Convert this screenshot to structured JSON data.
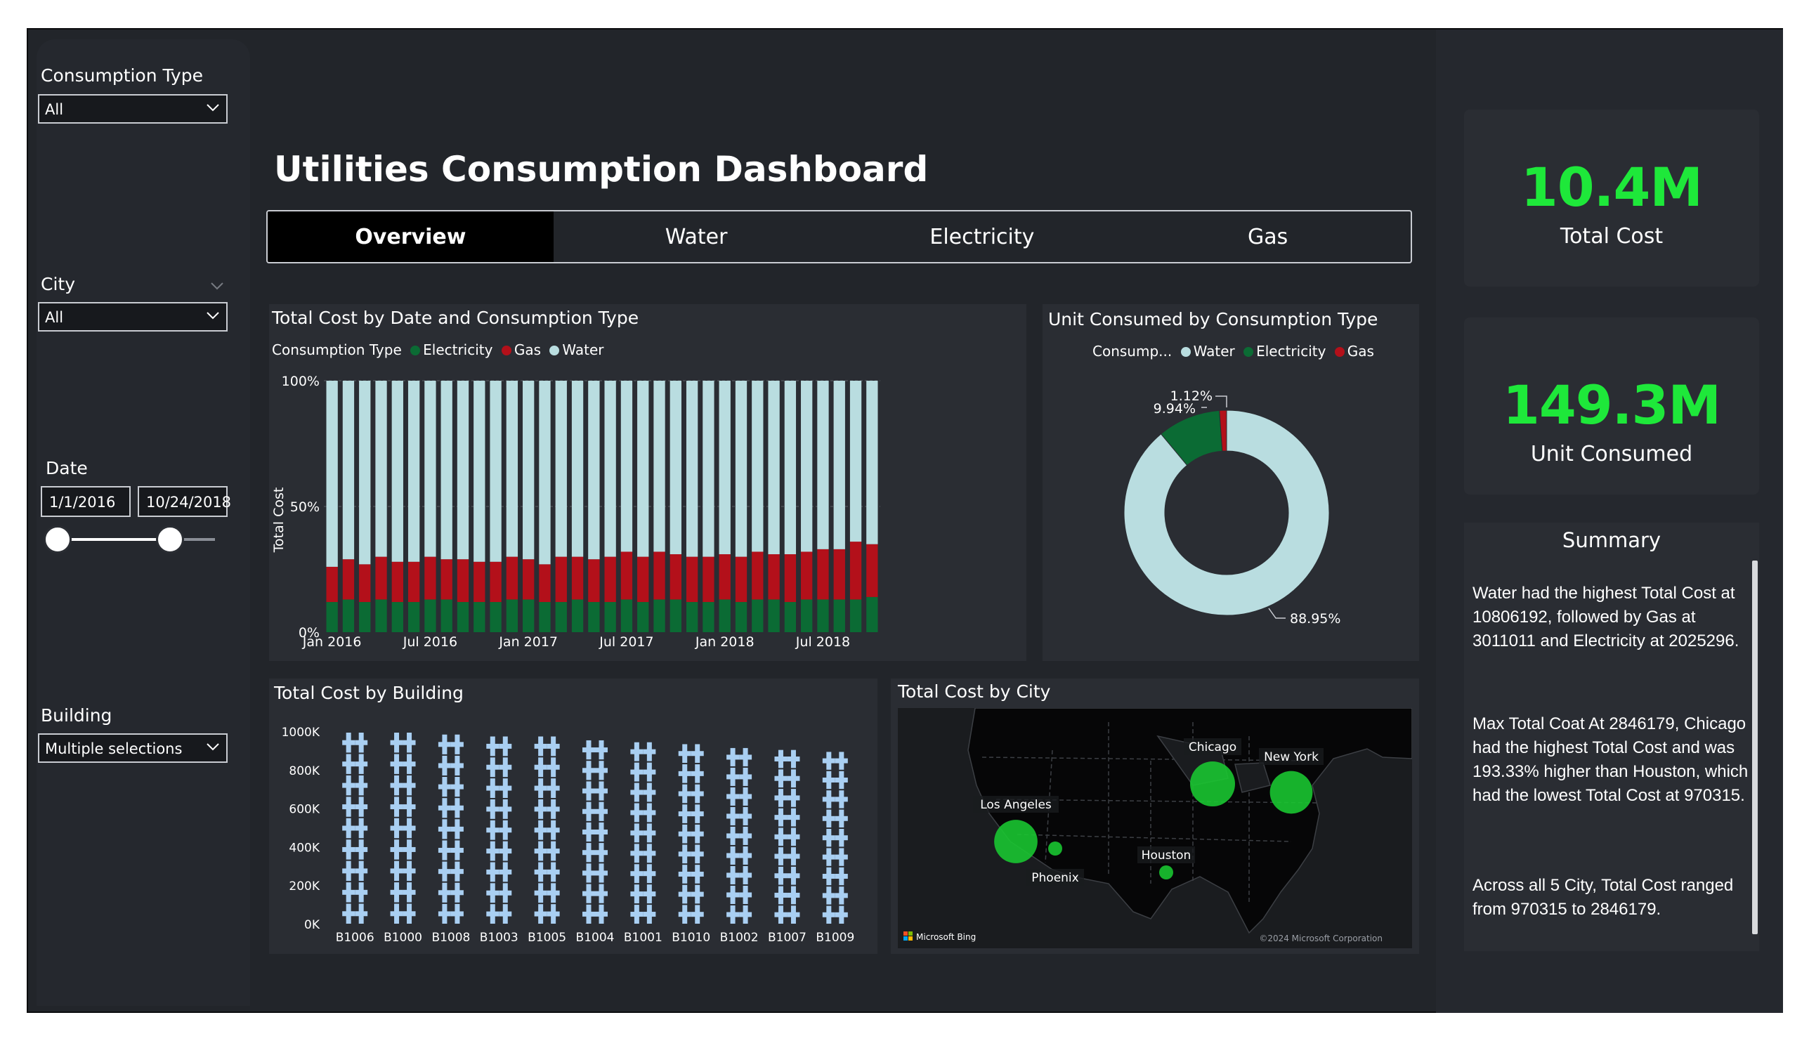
{
  "title": "Utilities Consumption Dashboard",
  "filters": {
    "consumption_type": {
      "label": "Consumption Type",
      "value": "All"
    },
    "city": {
      "label": "City",
      "value": "All"
    },
    "date": {
      "label": "Date",
      "start": "1/1/2016",
      "end": "10/24/2018"
    },
    "building": {
      "label": "Building",
      "value": "Multiple selections"
    }
  },
  "tabs": [
    {
      "label": "Overview",
      "active": true
    },
    {
      "label": "Water",
      "active": false
    },
    {
      "label": "Electricity",
      "active": false
    },
    {
      "label": "Gas",
      "active": false
    }
  ],
  "kpis": {
    "total_cost": {
      "value": "10.4M",
      "label": "Total Cost"
    },
    "unit_consumed": {
      "value": "149.3M",
      "label": "Unit Consumed"
    }
  },
  "summary": {
    "title": "Summary",
    "paragraphs": [
      "Water had the highest Total Cost at 10806192, followed by Gas at 3011011 and Electricity at 2025296.",
      "Max Total Coat  At 2846179, Chicago had the highest Total Cost and was 193.33% higher than Houston, which had the lowest Total Cost at 970315.",
      "Across all 5 City, Total Cost ranged from 970315 to 2846179."
    ]
  },
  "colors": {
    "electricity": "#0b6b34",
    "gas": "#b3101a",
    "water": "#b9dde0",
    "kpi": "#1ee83a",
    "map_bubble": "#19c531"
  },
  "chart_data": [
    {
      "type": "bar",
      "stacking": "percent",
      "title": "Total Cost by Date and Consumption Type",
      "legend_title": "Consumption Type",
      "ylabel": "Total Cost",
      "y_ticks": [
        "0%",
        "50%",
        "100%"
      ],
      "x_ticks": [
        "Jan 2016",
        "Jul 2016",
        "Jan 2017",
        "Jul 2017",
        "Jan 2018",
        "Jul 2018"
      ],
      "grid": true,
      "categories": [
        "2016-01",
        "2016-02",
        "2016-03",
        "2016-04",
        "2016-05",
        "2016-06",
        "2016-07",
        "2016-08",
        "2016-09",
        "2016-10",
        "2016-11",
        "2016-12",
        "2017-01",
        "2017-02",
        "2017-03",
        "2017-04",
        "2017-05",
        "2017-06",
        "2017-07",
        "2017-08",
        "2017-09",
        "2017-10",
        "2017-11",
        "2017-12",
        "2018-01",
        "2018-02",
        "2018-03",
        "2018-04",
        "2018-05",
        "2018-06",
        "2018-07",
        "2018-08",
        "2018-09",
        "2018-10"
      ],
      "series": [
        {
          "name": "Electricity",
          "values": [
            12,
            13,
            12,
            13,
            12,
            12,
            13,
            13,
            12,
            12,
            12,
            13,
            13,
            12,
            12,
            13,
            12,
            12,
            13,
            12,
            13,
            13,
            12,
            12,
            13,
            12,
            13,
            13,
            12,
            13,
            13,
            13,
            13,
            14
          ]
        },
        {
          "name": "Gas",
          "values": [
            14,
            16,
            15,
            17,
            16,
            16,
            17,
            16,
            17,
            16,
            16,
            17,
            16,
            15,
            18,
            17,
            17,
            18,
            19,
            18,
            19,
            18,
            18,
            18,
            18,
            18,
            19,
            18,
            19,
            19,
            20,
            20,
            23,
            21
          ]
        },
        {
          "name": "Water",
          "values": [
            74,
            71,
            73,
            70,
            72,
            72,
            70,
            71,
            71,
            72,
            72,
            70,
            71,
            73,
            70,
            70,
            71,
            70,
            68,
            70,
            68,
            69,
            70,
            70,
            69,
            70,
            68,
            69,
            69,
            68,
            67,
            67,
            64,
            65
          ]
        }
      ]
    },
    {
      "type": "pie",
      "donut": true,
      "title": "Unit Consumed by Consumption Type",
      "legend_title": "Consump...",
      "labels": [
        "Water",
        "Electricity",
        "Gas"
      ],
      "values": [
        88.95,
        9.94,
        1.12
      ],
      "value_labels": [
        "88.95%",
        "9.94%",
        "1.12%"
      ]
    },
    {
      "type": "bar",
      "style": "pictogram",
      "title": "Total Cost by Building",
      "categories": [
        "B1006",
        "B1000",
        "B1008",
        "B1003",
        "B1005",
        "B1004",
        "B1001",
        "B1010",
        "B1002",
        "B1007",
        "B1009"
      ],
      "values": [
        1000000,
        1000000,
        990000,
        980000,
        980000,
        960000,
        950000,
        940000,
        920000,
        910000,
        900000
      ],
      "y_ticks": [
        "0K",
        "200K",
        "400K",
        "600K",
        "800K",
        "1000K"
      ],
      "ylim": [
        0,
        1000000
      ]
    },
    {
      "type": "scatter",
      "style": "bubble-map",
      "title": "Total Cost by City",
      "points": [
        {
          "city": "Chicago",
          "value": 2846179
        },
        {
          "city": "New York",
          "value": 2500000
        },
        {
          "city": "Los Angeles",
          "value": 2600000
        },
        {
          "city": "Phoenix",
          "value": 1000000
        },
        {
          "city": "Houston",
          "value": 970315
        }
      ],
      "attribution": "Microsoft Bing",
      "copyright": "©2024 Microsoft Corporation"
    }
  ]
}
